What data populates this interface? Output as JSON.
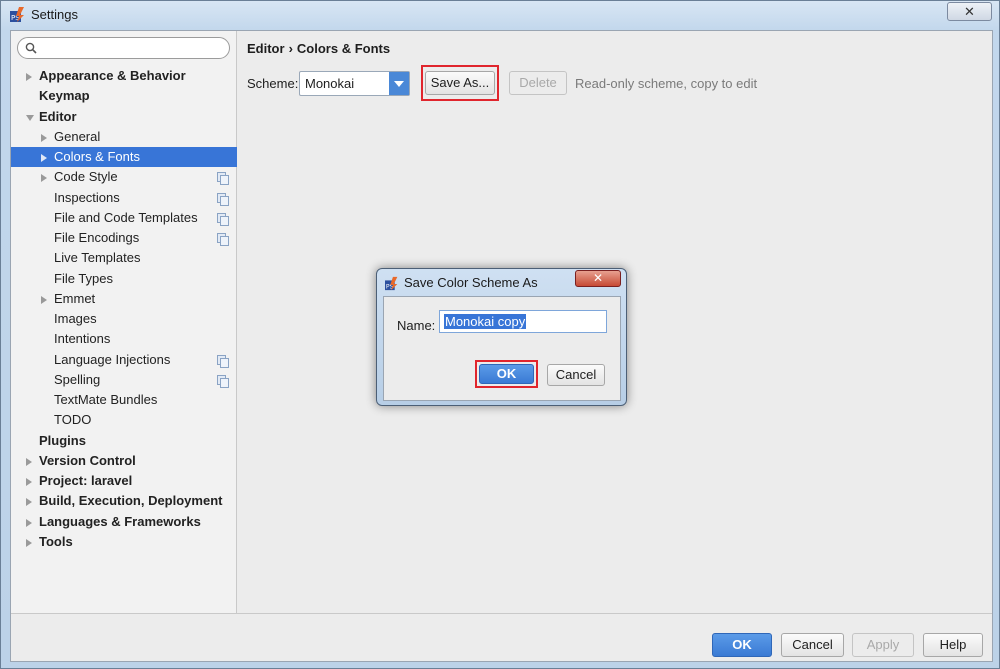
{
  "window": {
    "title": "Settings",
    "close_glyph": "✕"
  },
  "search": {
    "icon": "search-icon",
    "value": ""
  },
  "tree": [
    {
      "label": "Appearance & Behavior",
      "bold": true,
      "arrow": "right",
      "indent": 0
    },
    {
      "label": "Keymap",
      "bold": true,
      "arrow": "none",
      "indent": 0
    },
    {
      "label": "Editor",
      "bold": true,
      "arrow": "down",
      "indent": 0
    },
    {
      "label": "General",
      "bold": false,
      "arrow": "right",
      "indent": 1
    },
    {
      "label": "Colors & Fonts",
      "bold": false,
      "arrow": "right",
      "indent": 1,
      "selected": true
    },
    {
      "label": "Code Style",
      "bold": false,
      "arrow": "right",
      "indent": 1,
      "copy": true
    },
    {
      "label": "Inspections",
      "bold": false,
      "arrow": "none",
      "indent": 1,
      "copy": true
    },
    {
      "label": "File and Code Templates",
      "bold": false,
      "arrow": "none",
      "indent": 1,
      "copy": true
    },
    {
      "label": "File Encodings",
      "bold": false,
      "arrow": "none",
      "indent": 1,
      "copy": true
    },
    {
      "label": "Live Templates",
      "bold": false,
      "arrow": "none",
      "indent": 1
    },
    {
      "label": "File Types",
      "bold": false,
      "arrow": "none",
      "indent": 1
    },
    {
      "label": "Emmet",
      "bold": false,
      "arrow": "right",
      "indent": 1
    },
    {
      "label": "Images",
      "bold": false,
      "arrow": "none",
      "indent": 1
    },
    {
      "label": "Intentions",
      "bold": false,
      "arrow": "none",
      "indent": 1
    },
    {
      "label": "Language Injections",
      "bold": false,
      "arrow": "none",
      "indent": 1,
      "copy": true
    },
    {
      "label": "Spelling",
      "bold": false,
      "arrow": "none",
      "indent": 1,
      "copy": true
    },
    {
      "label": "TextMate Bundles",
      "bold": false,
      "arrow": "none",
      "indent": 1
    },
    {
      "label": "TODO",
      "bold": false,
      "arrow": "none",
      "indent": 1
    },
    {
      "label": "Plugins",
      "bold": true,
      "arrow": "none",
      "indent": 0
    },
    {
      "label": "Version Control",
      "bold": true,
      "arrow": "right",
      "indent": 0
    },
    {
      "label": "Project: laravel",
      "bold": true,
      "arrow": "right",
      "indent": 0
    },
    {
      "label": "Build, Execution, Deployment",
      "bold": true,
      "arrow": "right",
      "indent": 0
    },
    {
      "label": "Languages & Frameworks",
      "bold": true,
      "arrow": "right",
      "indent": 0
    },
    {
      "label": "Tools",
      "bold": true,
      "arrow": "right",
      "indent": 0
    }
  ],
  "breadcrumb": {
    "parent": "Editor",
    "separator": "›",
    "current": "Colors & Fonts"
  },
  "scheme": {
    "label": "Scheme:",
    "value": "Monokai",
    "save_as_label": "Save As...",
    "delete_label": "Delete",
    "note": "Read-only scheme, copy to edit"
  },
  "footer": {
    "ok_label": "OK",
    "cancel_label": "Cancel",
    "apply_label": "Apply",
    "help_label": "Help"
  },
  "dialog": {
    "title": "Save Color Scheme As",
    "close_glyph": "✕",
    "name_label": "Name:",
    "name_value": "Monokai copy",
    "ok_label": "OK",
    "cancel_label": "Cancel"
  },
  "colors": {
    "selection": "#3875d7",
    "highlight_box": "#e0252d",
    "primary_button": "#3a7ad4"
  }
}
